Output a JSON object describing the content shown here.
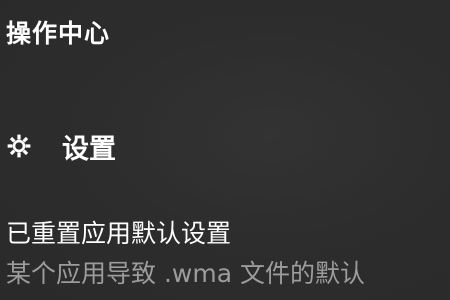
{
  "action_center": {
    "title": "操作中心"
  },
  "notification_source": {
    "icon": "gear-icon",
    "label": "设置"
  },
  "notification": {
    "heading": "已重置应用默认设置",
    "body": "某个应用导致 .wma 文件的默认"
  },
  "colors": {
    "background": "#2b2b2b",
    "primary_text": "#ffffff",
    "secondary_text": "#9c9c9c"
  }
}
